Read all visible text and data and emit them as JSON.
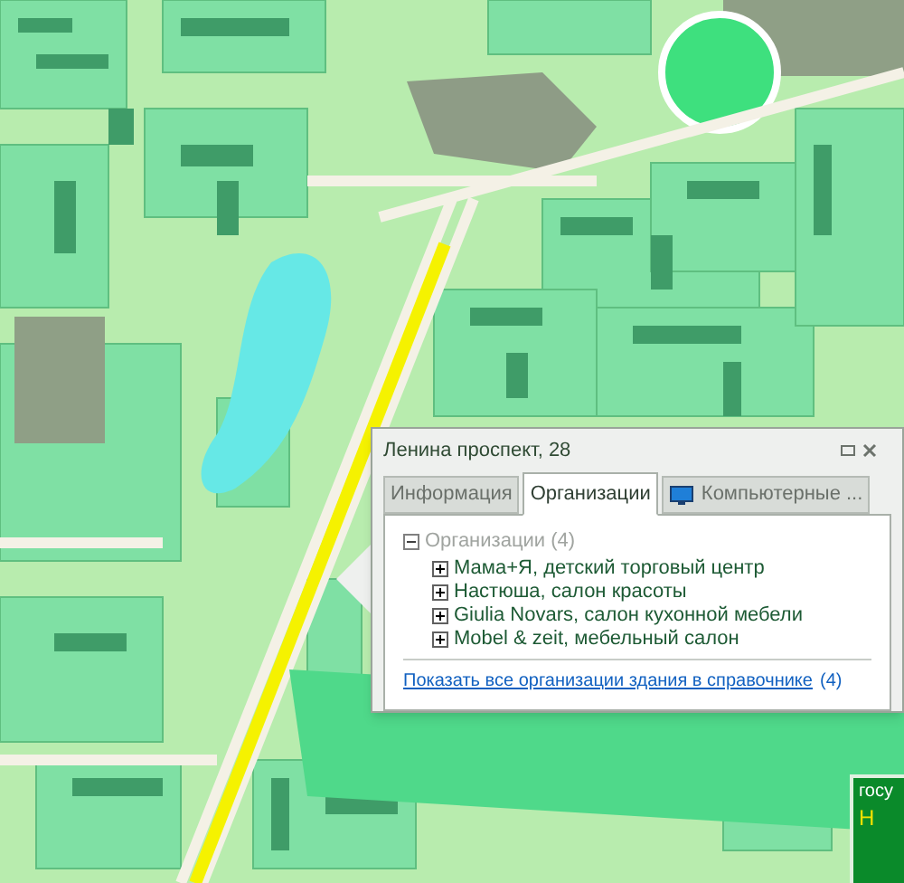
{
  "popup": {
    "title": "Ленина проспект, 28",
    "tabs": [
      {
        "label": "Информация",
        "selected": false,
        "icon": false
      },
      {
        "label": "Организации",
        "selected": true,
        "icon": false
      },
      {
        "label": "Компьютерные ...",
        "selected": false,
        "icon": true
      }
    ],
    "tree": {
      "label": "Организации (4)",
      "expanded": true,
      "children": [
        {
          "label": "Мама+Я, детский торговый центр",
          "expanded": false
        },
        {
          "label": "Настюша, салон красоты",
          "expanded": false
        },
        {
          "label": "Giulia Novars, салон кухонной мебели",
          "expanded": false
        },
        {
          "label": "Mobel & zeit, мебельный салон",
          "expanded": false
        }
      ]
    },
    "link": "Показать все организации здания в справочнике",
    "link_count": "(4)"
  },
  "map_sign": {
    "line_1": "госу",
    "line_2": "Н"
  }
}
